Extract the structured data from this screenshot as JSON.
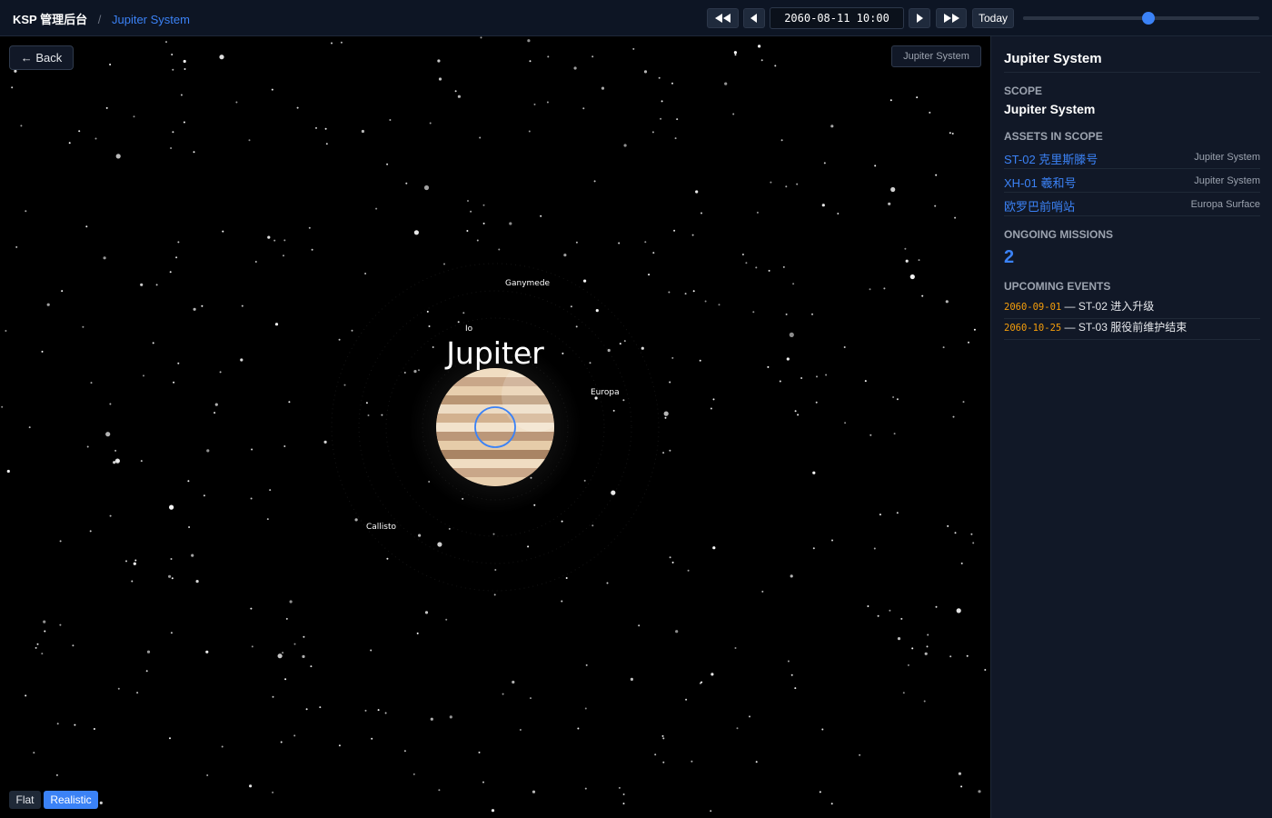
{
  "header": {
    "app_name": "KSP 管理后台",
    "separator": "/",
    "current": "Jupiter System"
  },
  "timebar": {
    "date": "2060-08-11 10:00",
    "today_label": "Today",
    "slider_fraction": 0.53,
    "icons": [
      "fast-rewind-icon",
      "step-back-icon",
      "step-forward-icon",
      "fast-forward-icon"
    ]
  },
  "map": {
    "back_label": "← Back",
    "scope_chip": "Jupiter System",
    "planet": "Jupiter",
    "moons": [
      "Io",
      "Europa",
      "Ganymede",
      "Callisto"
    ],
    "view_modes": [
      "Flat",
      "Realistic"
    ],
    "active_view": "Realistic"
  },
  "panel": {
    "title": "Jupiter System",
    "scope_label": "SCOPE",
    "scope_value": "Jupiter System",
    "assets_label": "ASSETS IN SCOPE",
    "assets": [
      {
        "name": "ST-02 克里斯滕号",
        "location": "Jupiter System"
      },
      {
        "name": "XH-01 羲和号",
        "location": "Jupiter System"
      },
      {
        "name": "欧罗巴前哨站",
        "location": "Europa Surface"
      }
    ],
    "missions_label": "ONGOING MISSIONS",
    "missions_count": "2",
    "events_label": "UPCOMING EVENTS",
    "events": [
      {
        "date": "2060-09-01",
        "text": " — ST-02 进入升级"
      },
      {
        "date": "2060-10-25",
        "text": " — ST-03 服役前维护结束"
      }
    ]
  },
  "colors": {
    "accent": "#3b82f6",
    "event_date": "#f59e0b",
    "panel_bg": "#111827",
    "topbar_bg": "#0d1524"
  }
}
